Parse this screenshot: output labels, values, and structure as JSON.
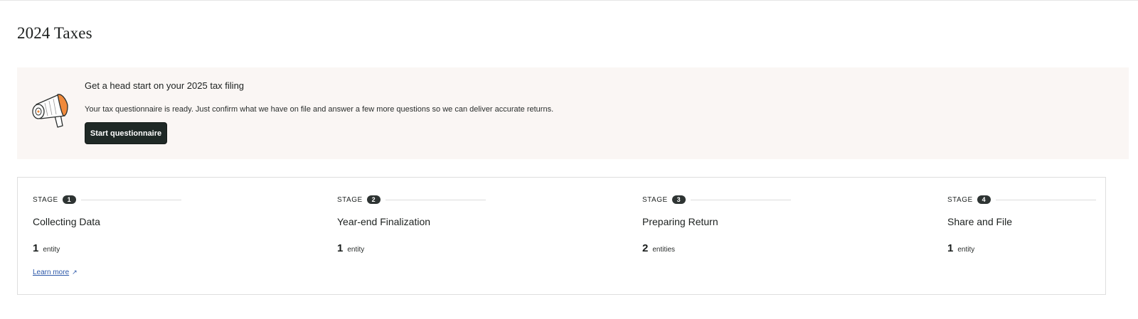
{
  "page": {
    "title": "2024 Taxes"
  },
  "banner": {
    "icon": "megaphone-icon",
    "title": "Get a head start on your 2025 tax filing",
    "description": "Your tax questionnaire is ready. Just confirm what we have on file and answer a few more questions so we can deliver accurate returns.",
    "button_label": "Start questionnaire",
    "colors": {
      "background": "#faf6f4",
      "button": "#1f2926",
      "accent": "#f08a3c"
    }
  },
  "stages": [
    {
      "label": "STAGE",
      "number": "1",
      "name": "Collecting Data",
      "count": "1",
      "unit": "entity",
      "link": "Learn more",
      "link_icon": "arrow-up-right-icon"
    },
    {
      "label": "STAGE",
      "number": "2",
      "name": "Year-end Finalization",
      "count": "1",
      "unit": "entity"
    },
    {
      "label": "STAGE",
      "number": "3",
      "name": "Preparing Return",
      "count": "2",
      "unit": "entities"
    },
    {
      "label": "STAGE",
      "number": "4",
      "name": "Share and File",
      "count": "1",
      "unit": "entity"
    }
  ],
  "link_color": "#2b57a8"
}
